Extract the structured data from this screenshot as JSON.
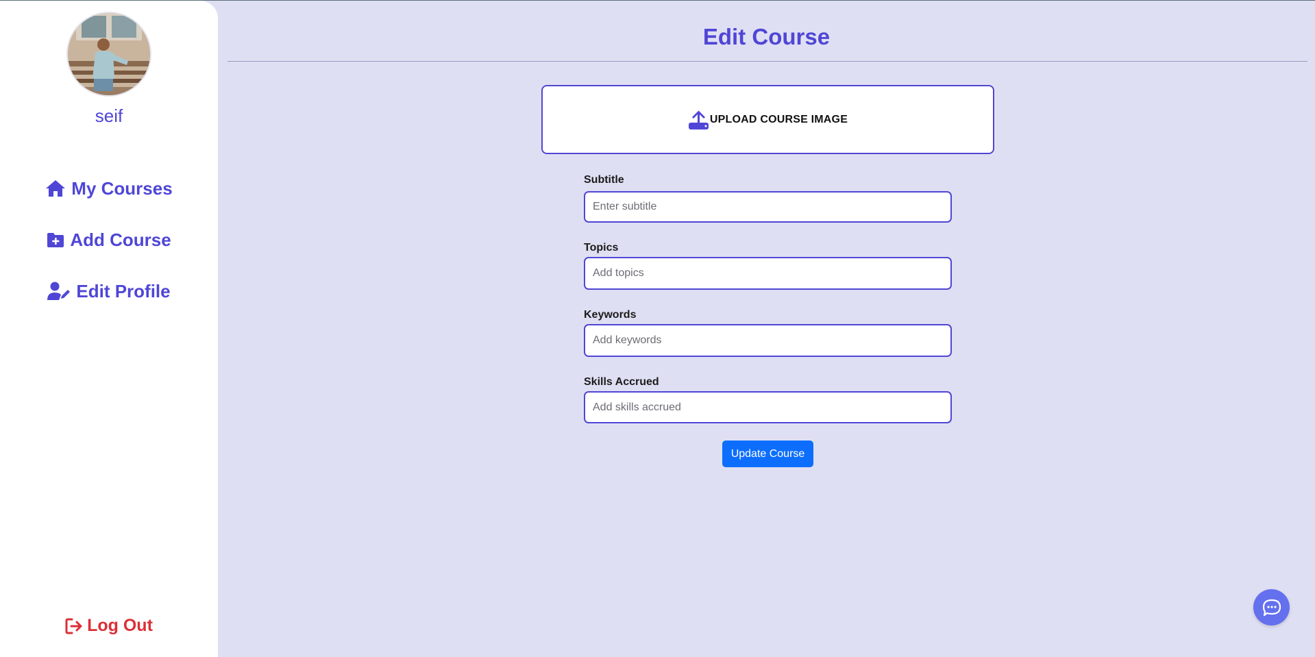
{
  "sidebar": {
    "username": "seif",
    "nav": [
      {
        "label": "My Courses",
        "icon": "home-icon"
      },
      {
        "label": "Add Course",
        "icon": "folder-plus-icon"
      },
      {
        "label": "Edit Profile",
        "icon": "user-edit-icon"
      }
    ],
    "logout": {
      "label": "Log Out",
      "icon": "logout-icon"
    }
  },
  "main": {
    "title": "Edit Course",
    "upload": {
      "label": "UPLOAD COURSE IMAGE",
      "icon": "upload-icon"
    },
    "fields": [
      {
        "label": "Subtitle",
        "placeholder": "Enter subtitle",
        "value": ""
      },
      {
        "label": "Topics",
        "placeholder": "Add topics",
        "value": ""
      },
      {
        "label": "Keywords",
        "placeholder": "Add keywords",
        "value": ""
      },
      {
        "label": "Skills Accrued",
        "placeholder": "Add skills accrued",
        "value": ""
      }
    ],
    "submit_label": "Update Course"
  },
  "chat": {
    "icon": "chat-bubble-icon"
  },
  "colors": {
    "accent": "#4f46d6",
    "background": "#dfdff3",
    "danger": "#dc2f36",
    "primary_button": "#0d6efd",
    "chat_button": "#6470ee"
  }
}
